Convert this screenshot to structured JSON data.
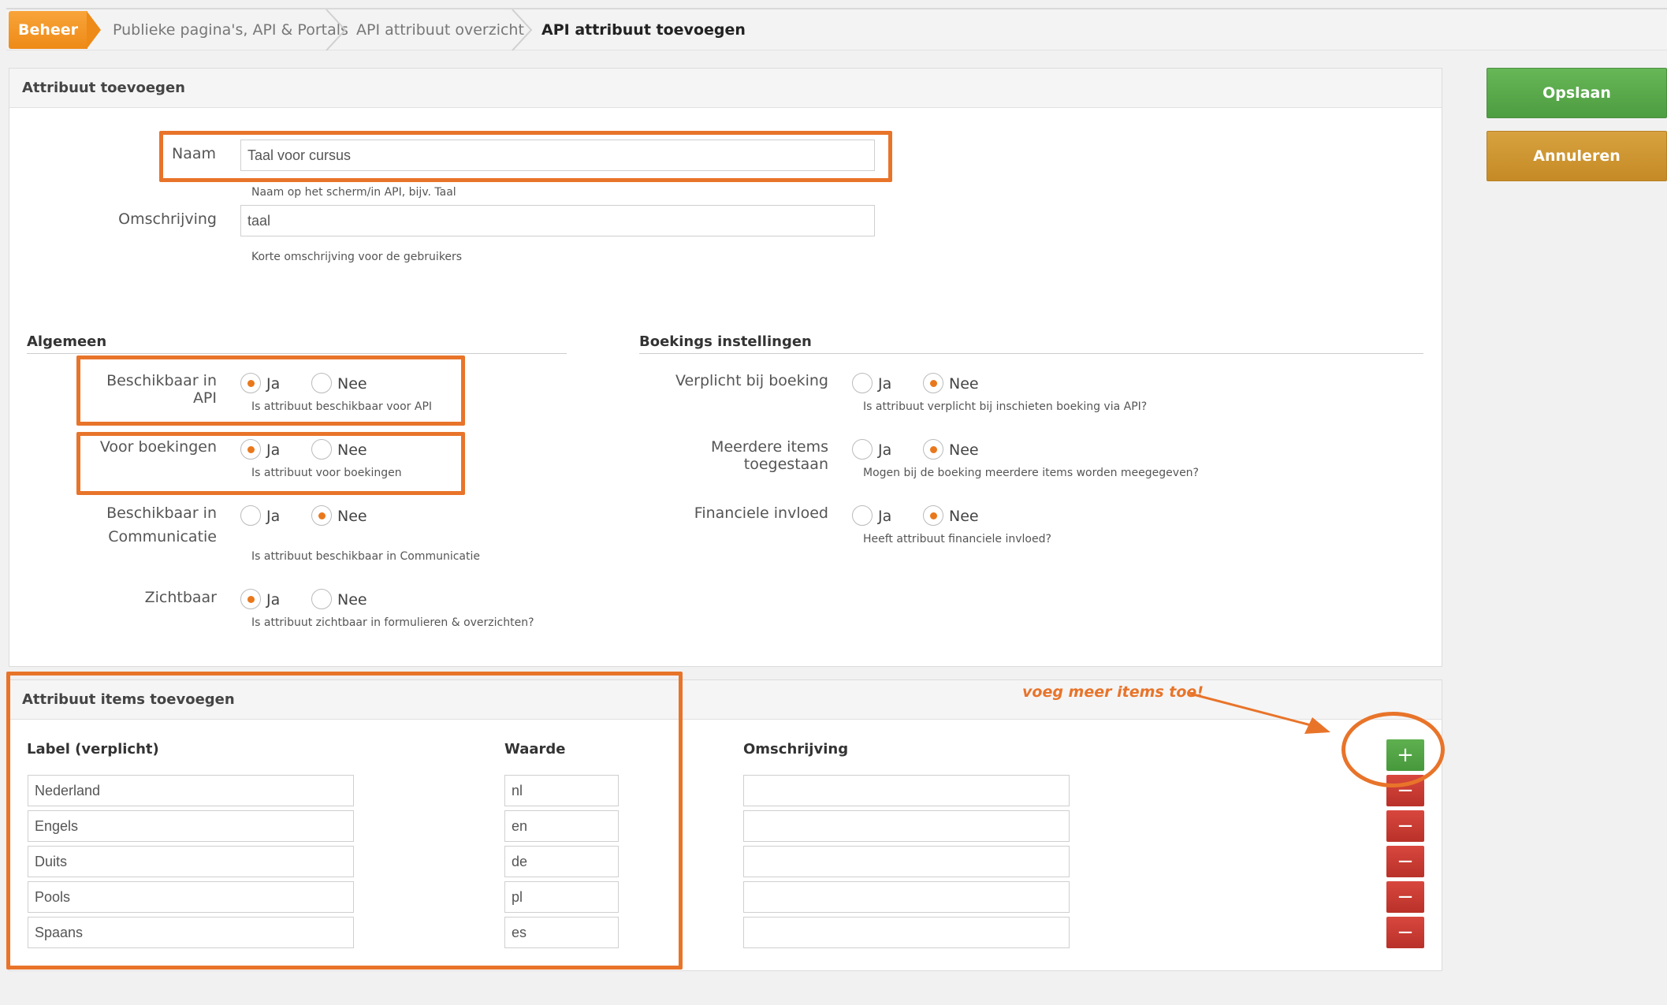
{
  "breadcrumb": {
    "items": [
      "Beheer",
      "Publieke pagina's, API & Portals",
      "API attribuut overzicht",
      "API attribuut toevoegen"
    ]
  },
  "actions": {
    "save": "Opslaan",
    "cancel": "Annuleren"
  },
  "panel1": {
    "title": "Attribuut toevoegen",
    "name_label": "Naam",
    "name_value": "Taal voor cursus",
    "name_hint": "Naam op het scherm/in API, bijv. Taal",
    "desc_label": "Omschrijving",
    "desc_value": "taal",
    "desc_hint": "Korte omschrijving voor de gebruikers"
  },
  "general": {
    "title": "Algemeen",
    "yes": "Ja",
    "no": "Nee",
    "rows": [
      {
        "label": "Beschikbaar in API",
        "selected": "Ja",
        "hint": "Is attribuut beschikbaar voor API"
      },
      {
        "label": "Voor boekingen",
        "selected": "Ja",
        "hint": "Is attribuut voor boekingen"
      },
      {
        "label1": "Beschikbaar in",
        "label2": "Communicatie",
        "selected": "Nee",
        "hint": "Is attribuut beschikbaar in Communicatie"
      },
      {
        "label": "Zichtbaar",
        "selected": "Ja",
        "hint": "Is attribuut zichtbaar in formulieren & overzichten?"
      }
    ]
  },
  "booking": {
    "title": "Boekings instellingen",
    "rows": [
      {
        "label": "Verplicht bij boeking",
        "selected": "Nee",
        "hint": "Is attribuut verplicht bij inschieten boeking via API?"
      },
      {
        "label": "Meerdere items toegestaan",
        "selected": "Nee",
        "hint": "Mogen bij de boeking meerdere items worden meegegeven?"
      },
      {
        "label": "Financiele invloed",
        "selected": "Nee",
        "hint": "Heeft attribuut financiele invloed?"
      }
    ]
  },
  "items": {
    "title": "Attribuut items toevoegen",
    "col_label": "Label (verplicht)",
    "col_value": "Waarde",
    "col_desc": "Omschrijving",
    "rows": [
      {
        "label": "Nederland",
        "value": "nl",
        "desc": ""
      },
      {
        "label": "Engels",
        "value": "en",
        "desc": ""
      },
      {
        "label": "Duits",
        "value": "de",
        "desc": ""
      },
      {
        "label": "Pools",
        "value": "pl",
        "desc": ""
      },
      {
        "label": "Spaans",
        "value": "es",
        "desc": ""
      }
    ],
    "add_symbol": "+",
    "remove_symbol": "−"
  },
  "annotation": {
    "callout": "voeg meer items toe!"
  },
  "colors": {
    "accent": "#e8742a",
    "save": "#56a848",
    "cancel": "#cb922e",
    "remove": "#c9382f"
  }
}
